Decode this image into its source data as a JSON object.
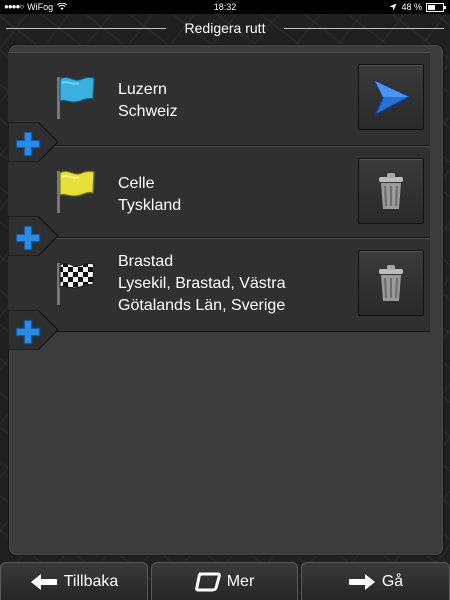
{
  "status_bar": {
    "signal": "●●●●○",
    "carrier": "WiFog",
    "time": "18:32",
    "battery_text": "48 %",
    "battery_level": 0.48
  },
  "header": {
    "title": "Redigera rutt"
  },
  "route": {
    "waypoints": [
      {
        "name": "Luzern",
        "detail_lines": [
          "Schweiz"
        ],
        "flag_icon": "blue-flag-icon",
        "action_icon": "navigate-arrow-icon"
      },
      {
        "name": "Celle",
        "detail_lines": [
          "Tyskland"
        ],
        "flag_icon": "yellow-flag-icon",
        "action_icon": "trash-can-icon"
      },
      {
        "name": "Brastad",
        "detail_lines": [
          "Lysekil, Brastad, Västra",
          "Götalands Län, Sverige"
        ],
        "flag_icon": "checkered-flag-icon",
        "action_icon": "trash-can-icon"
      }
    ],
    "insert_icon": "plus-icon"
  },
  "bottom_bar": {
    "back_label": "Tillbaka",
    "more_label": "Mer",
    "go_label": "Gå"
  },
  "colors": {
    "accent_blue": "#1e78d0",
    "panel": "#3c3c3c",
    "row": "#303030"
  }
}
